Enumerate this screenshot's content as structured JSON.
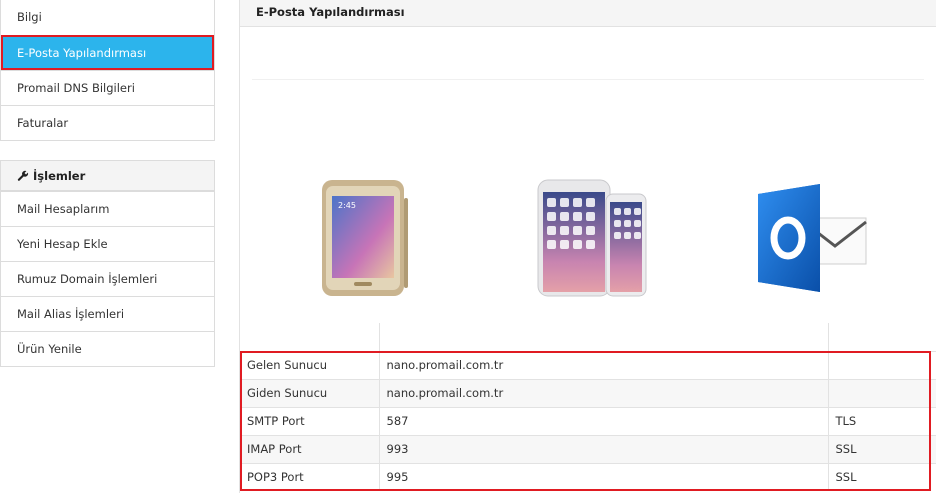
{
  "sidebar": {
    "items": [
      {
        "label": "Bilgi"
      },
      {
        "label": "E-Posta Yapılandırması",
        "active": true
      },
      {
        "label": "Promail DNS Bilgileri"
      },
      {
        "label": "Faturalar"
      }
    ],
    "group2": {
      "header": "İşlemler",
      "icon": "wrench-icon",
      "items": [
        {
          "label": "Mail Hesaplarım"
        },
        {
          "label": "Yeni Hesap Ekle"
        },
        {
          "label": "Rumuz Domain İşlemleri"
        },
        {
          "label": "Mail Alias İşlemleri"
        },
        {
          "label": "Ürün Yenile"
        }
      ]
    }
  },
  "panel": {
    "title": "E-Posta Yapılandırması",
    "devices": [
      "android-phone-image",
      "iphone-image",
      "outlook-logo"
    ]
  },
  "table": {
    "rows": [
      {
        "name": "Gelen Sunucu",
        "value": "nano.promail.com.tr",
        "security": ""
      },
      {
        "name": "Giden Sunucu",
        "value": "nano.promail.com.tr",
        "security": ""
      },
      {
        "name": "SMTP Port",
        "value": "587",
        "security": "TLS"
      },
      {
        "name": "IMAP Port",
        "value": "993",
        "security": "SSL"
      },
      {
        "name": "POP3 Port",
        "value": "995",
        "security": "SSL"
      }
    ]
  },
  "colors": {
    "accent": "#2cb4ec",
    "highlight": "#e01b22",
    "outlook": "#0a64c8"
  }
}
